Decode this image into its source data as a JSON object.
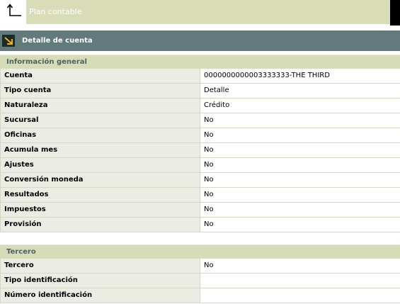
{
  "header": {
    "title": "Plan contable"
  },
  "detail": {
    "title": "Detalle de cuenta"
  },
  "general": {
    "title": "Información general",
    "rows": [
      {
        "label": "Cuenta",
        "value": "0000000000003333333-THE THIRD"
      },
      {
        "label": "Tipo cuenta",
        "value": "Detalle"
      },
      {
        "label": "Naturaleza",
        "value": "Crédito"
      },
      {
        "label": "Sucursal",
        "value": "No"
      },
      {
        "label": "Oficinas",
        "value": "No"
      },
      {
        "label": "Acumula mes",
        "value": "No"
      },
      {
        "label": "Ajustes",
        "value": "No"
      },
      {
        "label": "Conversión moneda",
        "value": "No"
      },
      {
        "label": "Resultados",
        "value": "No"
      },
      {
        "label": "Impuestos",
        "value": "No"
      },
      {
        "label": "Provisión",
        "value": "No"
      }
    ]
  },
  "tercero": {
    "title": "Tercero",
    "rows": [
      {
        "label": "Tercero",
        "value": "No"
      },
      {
        "label": "Tipo identificación",
        "value": ""
      },
      {
        "label": "Número identificación",
        "value": ""
      }
    ]
  }
}
